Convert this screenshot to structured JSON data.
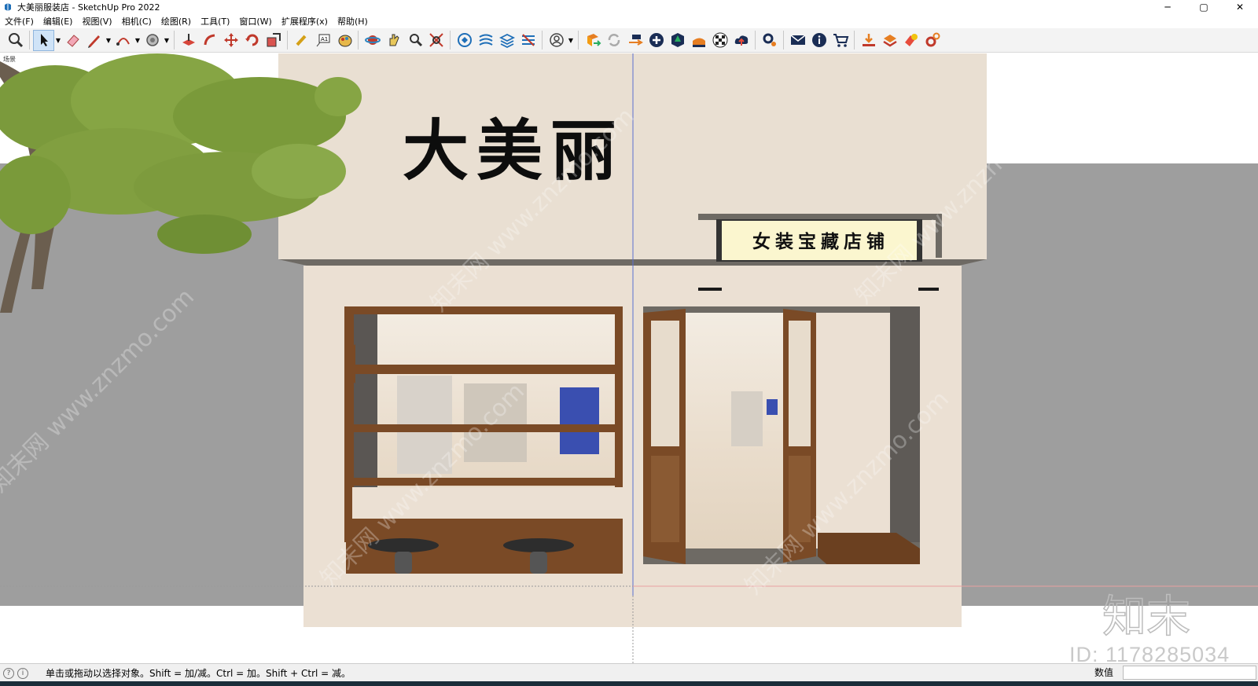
{
  "window": {
    "title": "大美丽服装店 - SketchUp Pro 2022",
    "min": "─",
    "max": "▢",
    "close": "✕"
  },
  "menu": [
    "文件(F)",
    "编辑(E)",
    "视图(V)",
    "相机(C)",
    "绘图(R)",
    "工具(T)",
    "窗口(W)",
    "扩展程序(x)",
    "帮助(H)"
  ],
  "toolbar_icons": [
    "zoom-icon",
    "select-icon",
    "eraser-icon",
    "pencil-icon",
    "arc-icon",
    "paint-bucket-icon",
    "push-pull-icon",
    "follow-me-icon",
    "move-icon",
    "rotate-icon",
    "scale-icon",
    "tape-measure-icon",
    "text-icon",
    "paint-icon",
    "orbit-icon",
    "pan-icon",
    "zoom-window-icon",
    "zoom-extents-icon",
    "components-icon",
    "materials-icon",
    "styles-icon",
    "layers-icon",
    "account-icon",
    "extension-warehouse-icon",
    "refresh-icon",
    "trimble-connect-icon",
    "add-location-icon",
    "3d-warehouse-icon",
    "photo-textures-icon",
    "checker-icon",
    "upload-icon",
    "settings-icon",
    "mail-icon",
    "info-icon",
    "cart-icon",
    "download-icon",
    "share-icon",
    "plugin-icon",
    "gear-icon"
  ],
  "scene": {
    "tab": "场景",
    "store_name": "大美丽",
    "sign_text": "女装宝藏店铺",
    "watermark": "知末网 www.znzmo.com"
  },
  "status": {
    "hint": "单击或拖动以选择对象。Shift = 加/减。Ctrl = 加。Shift + Ctrl = 减。",
    "measure_label": "数值",
    "measure_value": ""
  },
  "overlay": {
    "logo": "知末",
    "id": "ID: 1178285034"
  },
  "colors": {
    "wall": "#e9dfd2",
    "wood": "#7a4a26",
    "sign_bg": "#fbf6cf",
    "ground": "#9e9e9e"
  }
}
